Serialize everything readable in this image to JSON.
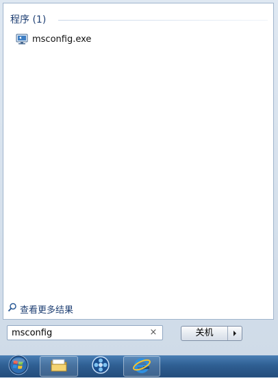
{
  "start_menu": {
    "section": {
      "title": "程序 (1)"
    },
    "results": [
      {
        "label": "msconfig.exe",
        "icon": "monitor-settings-icon"
      }
    ],
    "see_more": {
      "label": "查看更多结果",
      "icon": "search-icon"
    },
    "search": {
      "value": "msconfig",
      "clear_icon": "close-icon",
      "clear_symbol": "×"
    },
    "shutdown": {
      "label": "关机",
      "arrow_icon": "chevron-right-icon"
    }
  },
  "taskbar": {
    "items": [
      {
        "name": "start-button",
        "icon": "windows-orb-icon"
      },
      {
        "name": "explorer",
        "icon": "folder-icon"
      },
      {
        "name": "media-player",
        "icon": "film-reel-icon"
      },
      {
        "name": "internet-explorer",
        "icon": "ie-logo-icon"
      }
    ]
  },
  "colors": {
    "header_text": "#1e3f73",
    "taskbar": "#2f5f93",
    "border": "#9fb4cc"
  }
}
